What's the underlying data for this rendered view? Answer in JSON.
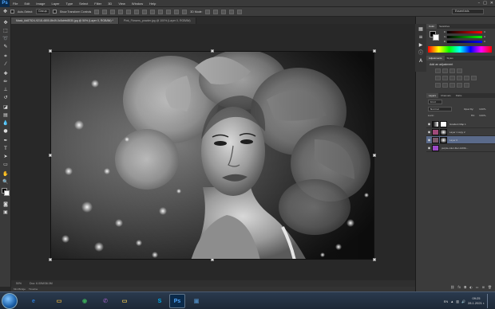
{
  "app": {
    "logo": "Ps",
    "menus": [
      "File",
      "Edit",
      "Image",
      "Layer",
      "Type",
      "Select",
      "Filter",
      "3D",
      "View",
      "Window",
      "Help"
    ],
    "window_controls": [
      "–",
      "□",
      "✕"
    ]
  },
  "options_bar": {
    "auto_select_label": "Auto-Select:",
    "auto_select_value": "Group",
    "show_transform_label": "Show Transform Controls",
    "mode_3d_label": "3D Mode:",
    "workspace": "Essentials"
  },
  "tabs": [
    {
      "label": "Mask_6d87524-9218-4800-8b49-0c5cfeb8530.jpg @ 50% (Layer 0, RGB/8#) *",
      "active": true
    },
    {
      "label": "Pink_Flowers_powder.jpg @ 100% (Layer 0, RGB/8#)",
      "active": false
    }
  ],
  "status": {
    "zoom": "50%",
    "doc_info": "Doc: 6.00M/36.0M"
  },
  "bottom_tabs": [
    "Mini Bridge",
    "Timeline"
  ],
  "panels": {
    "color_tabs": [
      "Color",
      "Swatches"
    ],
    "color_channels": [
      {
        "label": "R",
        "value": "0"
      },
      {
        "label": "G",
        "value": "0"
      },
      {
        "label": "B",
        "value": "0"
      }
    ],
    "adjustments_tabs": [
      "Adjustments",
      "Styles"
    ],
    "adjustments_title": "Add an adjustment",
    "layers_tabs": [
      "Layers",
      "Channels",
      "Paths"
    ],
    "layers_kind": "Kind",
    "blend_mode": "Normal",
    "opacity_label": "Opacity:",
    "opacity_value": "100%",
    "lock_label": "Lock:",
    "fill_label": "Fill:",
    "fill_value": "100%",
    "layers": [
      {
        "name": "Gradient Map 1",
        "selected": false
      },
      {
        "name": "Layer 1 copy 2",
        "selected": false
      },
      {
        "name": "Layer 0",
        "selected": true
      },
      {
        "name": "purple-color-fiter-1200x...",
        "selected": false
      }
    ]
  },
  "taskbar": {
    "apps": [
      {
        "name": "Internet Explorer",
        "glyph": "e",
        "color": "#2b7bd6"
      },
      {
        "name": "File Explorer",
        "glyph": "▭",
        "color": "#e0b040"
      },
      {
        "name": "Chrome",
        "glyph": "◉",
        "color": "#3aa757"
      },
      {
        "name": "Viber",
        "glyph": "✆",
        "color": "#7b519d"
      },
      {
        "name": "Folder",
        "glyph": "▭",
        "color": "#e8c350"
      },
      {
        "name": "Skype",
        "glyph": "S",
        "color": "#00aff0"
      },
      {
        "name": "Photoshop",
        "glyph": "Ps",
        "color": "#0b2a4a"
      },
      {
        "name": "Photo Viewer",
        "glyph": "▣",
        "color": "#4a7fb0"
      }
    ],
    "language": "EN",
    "time": "09:25",
    "date": "28.1.2021 г."
  }
}
